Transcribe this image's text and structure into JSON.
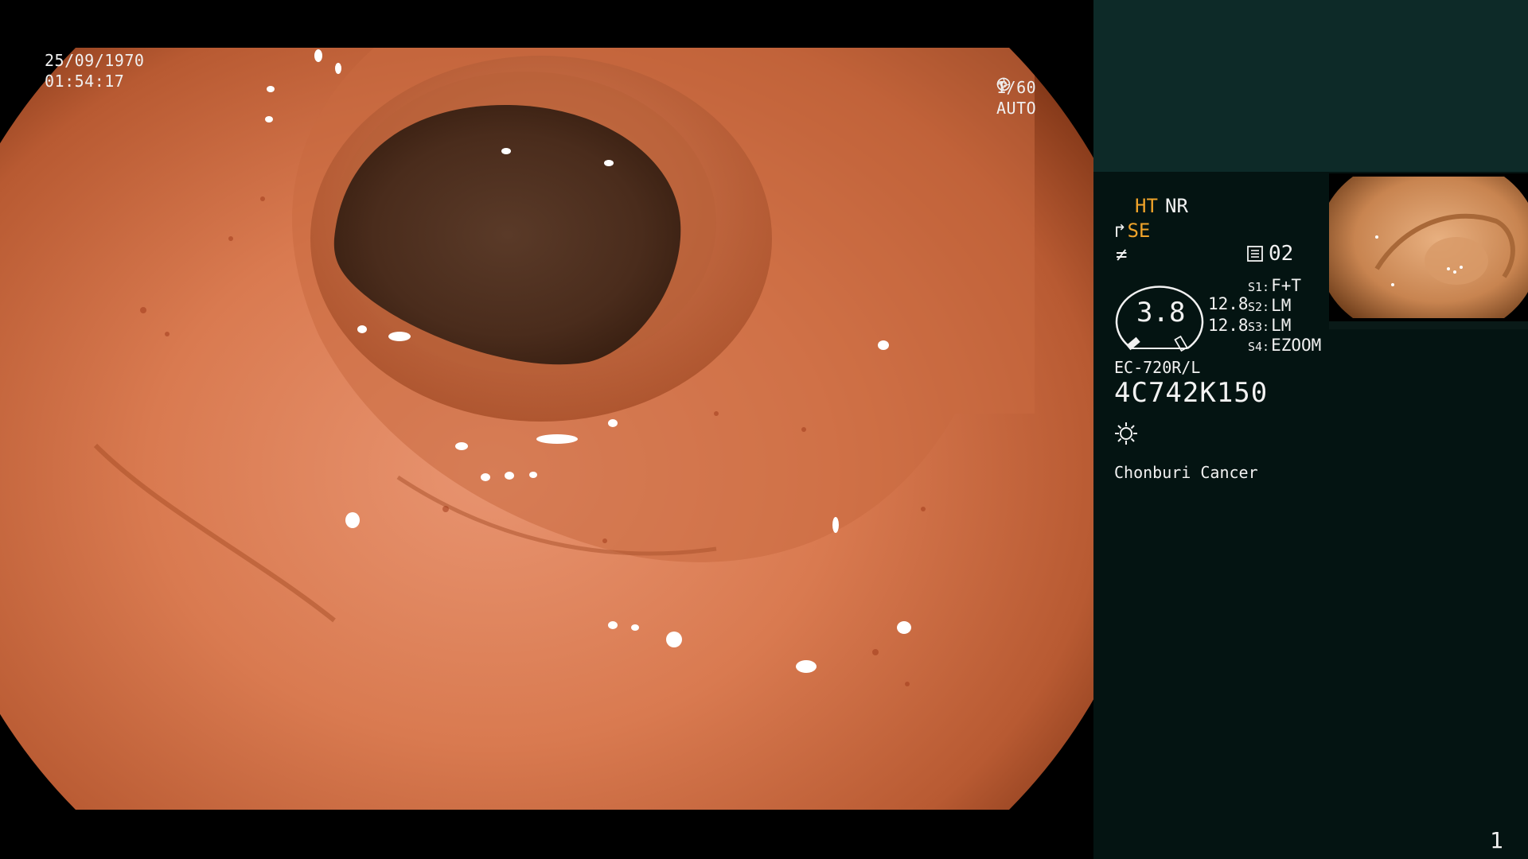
{
  "overlay": {
    "date": "25/09/1970",
    "time": "01:54:17",
    "shutter": "1/60",
    "iris_mode": "AUTO",
    "shutter_icon": "aperture-icon",
    "iris_icon": "iris-icon"
  },
  "panel": {
    "modes": {
      "ht": "HT",
      "nr": "NR",
      "se": "SE",
      "f": "≠"
    },
    "memo_number": "02",
    "zoom_value": "3.8",
    "value_1": "12.8",
    "value_2": "12.8",
    "switches": [
      {
        "key": "S1:",
        "value": "F+T"
      },
      {
        "key": "S2:",
        "value": "LM"
      },
      {
        "key": "S3:",
        "value": "LM"
      },
      {
        "key": "S4:",
        "value": "EZOOM"
      }
    ],
    "scope_model": "EC-720R/L",
    "scope_serial": "4C742K150",
    "site": "Chonburi Cancer",
    "page_number": "1"
  },
  "colors": {
    "accent_orange": "#f0a32a",
    "panel_top": "#0d2a28",
    "panel_body": "#041412",
    "tissue": "#d9774e"
  }
}
